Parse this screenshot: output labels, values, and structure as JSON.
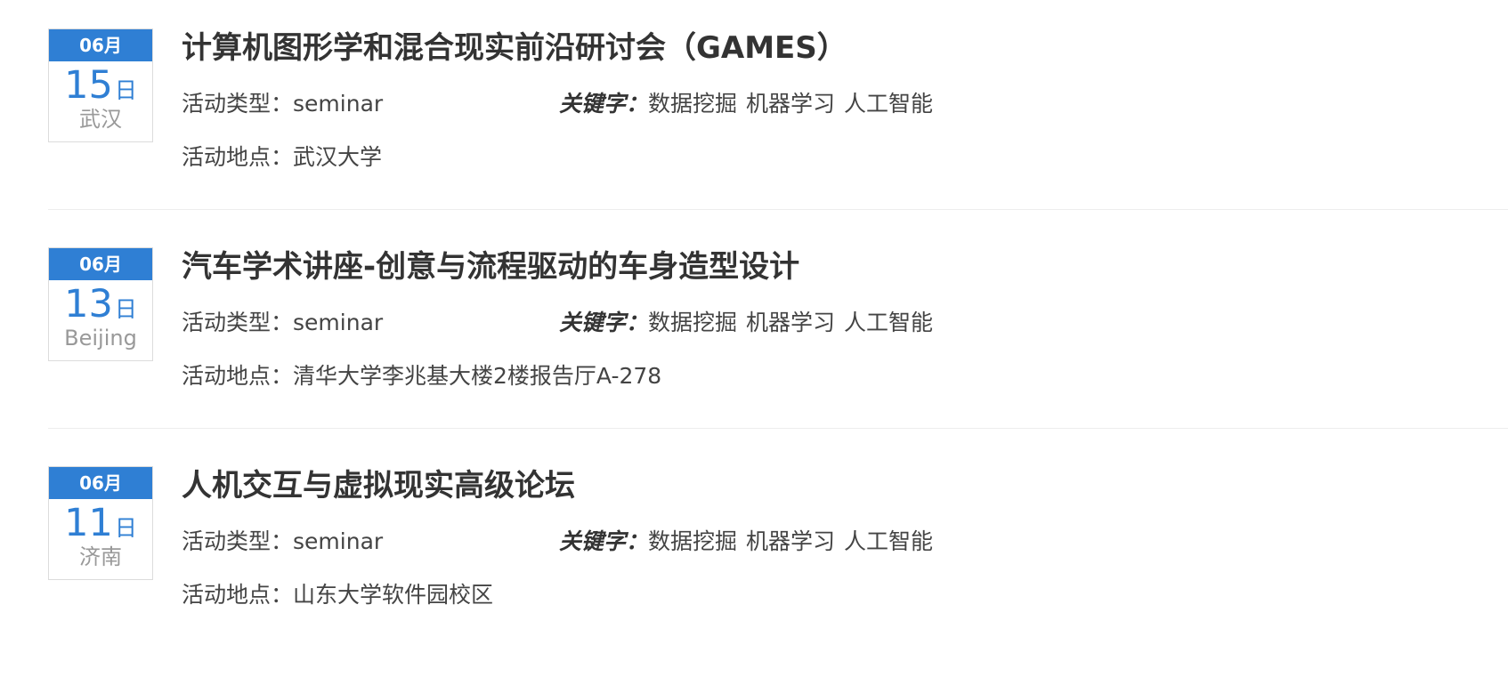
{
  "labels": {
    "type_label": "活动类型：",
    "location_label": "活动地点：",
    "keywords_label": "关键字：",
    "day_unit": "日"
  },
  "events": [
    {
      "month": "06月",
      "day": "15",
      "city": "武汉",
      "title": "计算机图形学和混合现实前沿研讨会（GAMES）",
      "type": "seminar",
      "location": "武汉大学",
      "keywords": [
        "数据挖掘",
        "机器学习",
        "人工智能"
      ]
    },
    {
      "month": "06月",
      "day": "13",
      "city": "Beijing",
      "title": "汽车学术讲座-创意与流程驱动的车身造型设计",
      "type": "seminar",
      "location": "清华大学李兆基大楼2楼报告厅A-278",
      "keywords": [
        "数据挖掘",
        "机器学习",
        "人工智能"
      ]
    },
    {
      "month": "06月",
      "day": "11",
      "city": "济南",
      "title": "人机交互与虚拟现实高级论坛",
      "type": "seminar",
      "location": "山东大学软件园校区",
      "keywords": [
        "数据挖掘",
        "机器学习",
        "人工智能"
      ]
    }
  ]
}
